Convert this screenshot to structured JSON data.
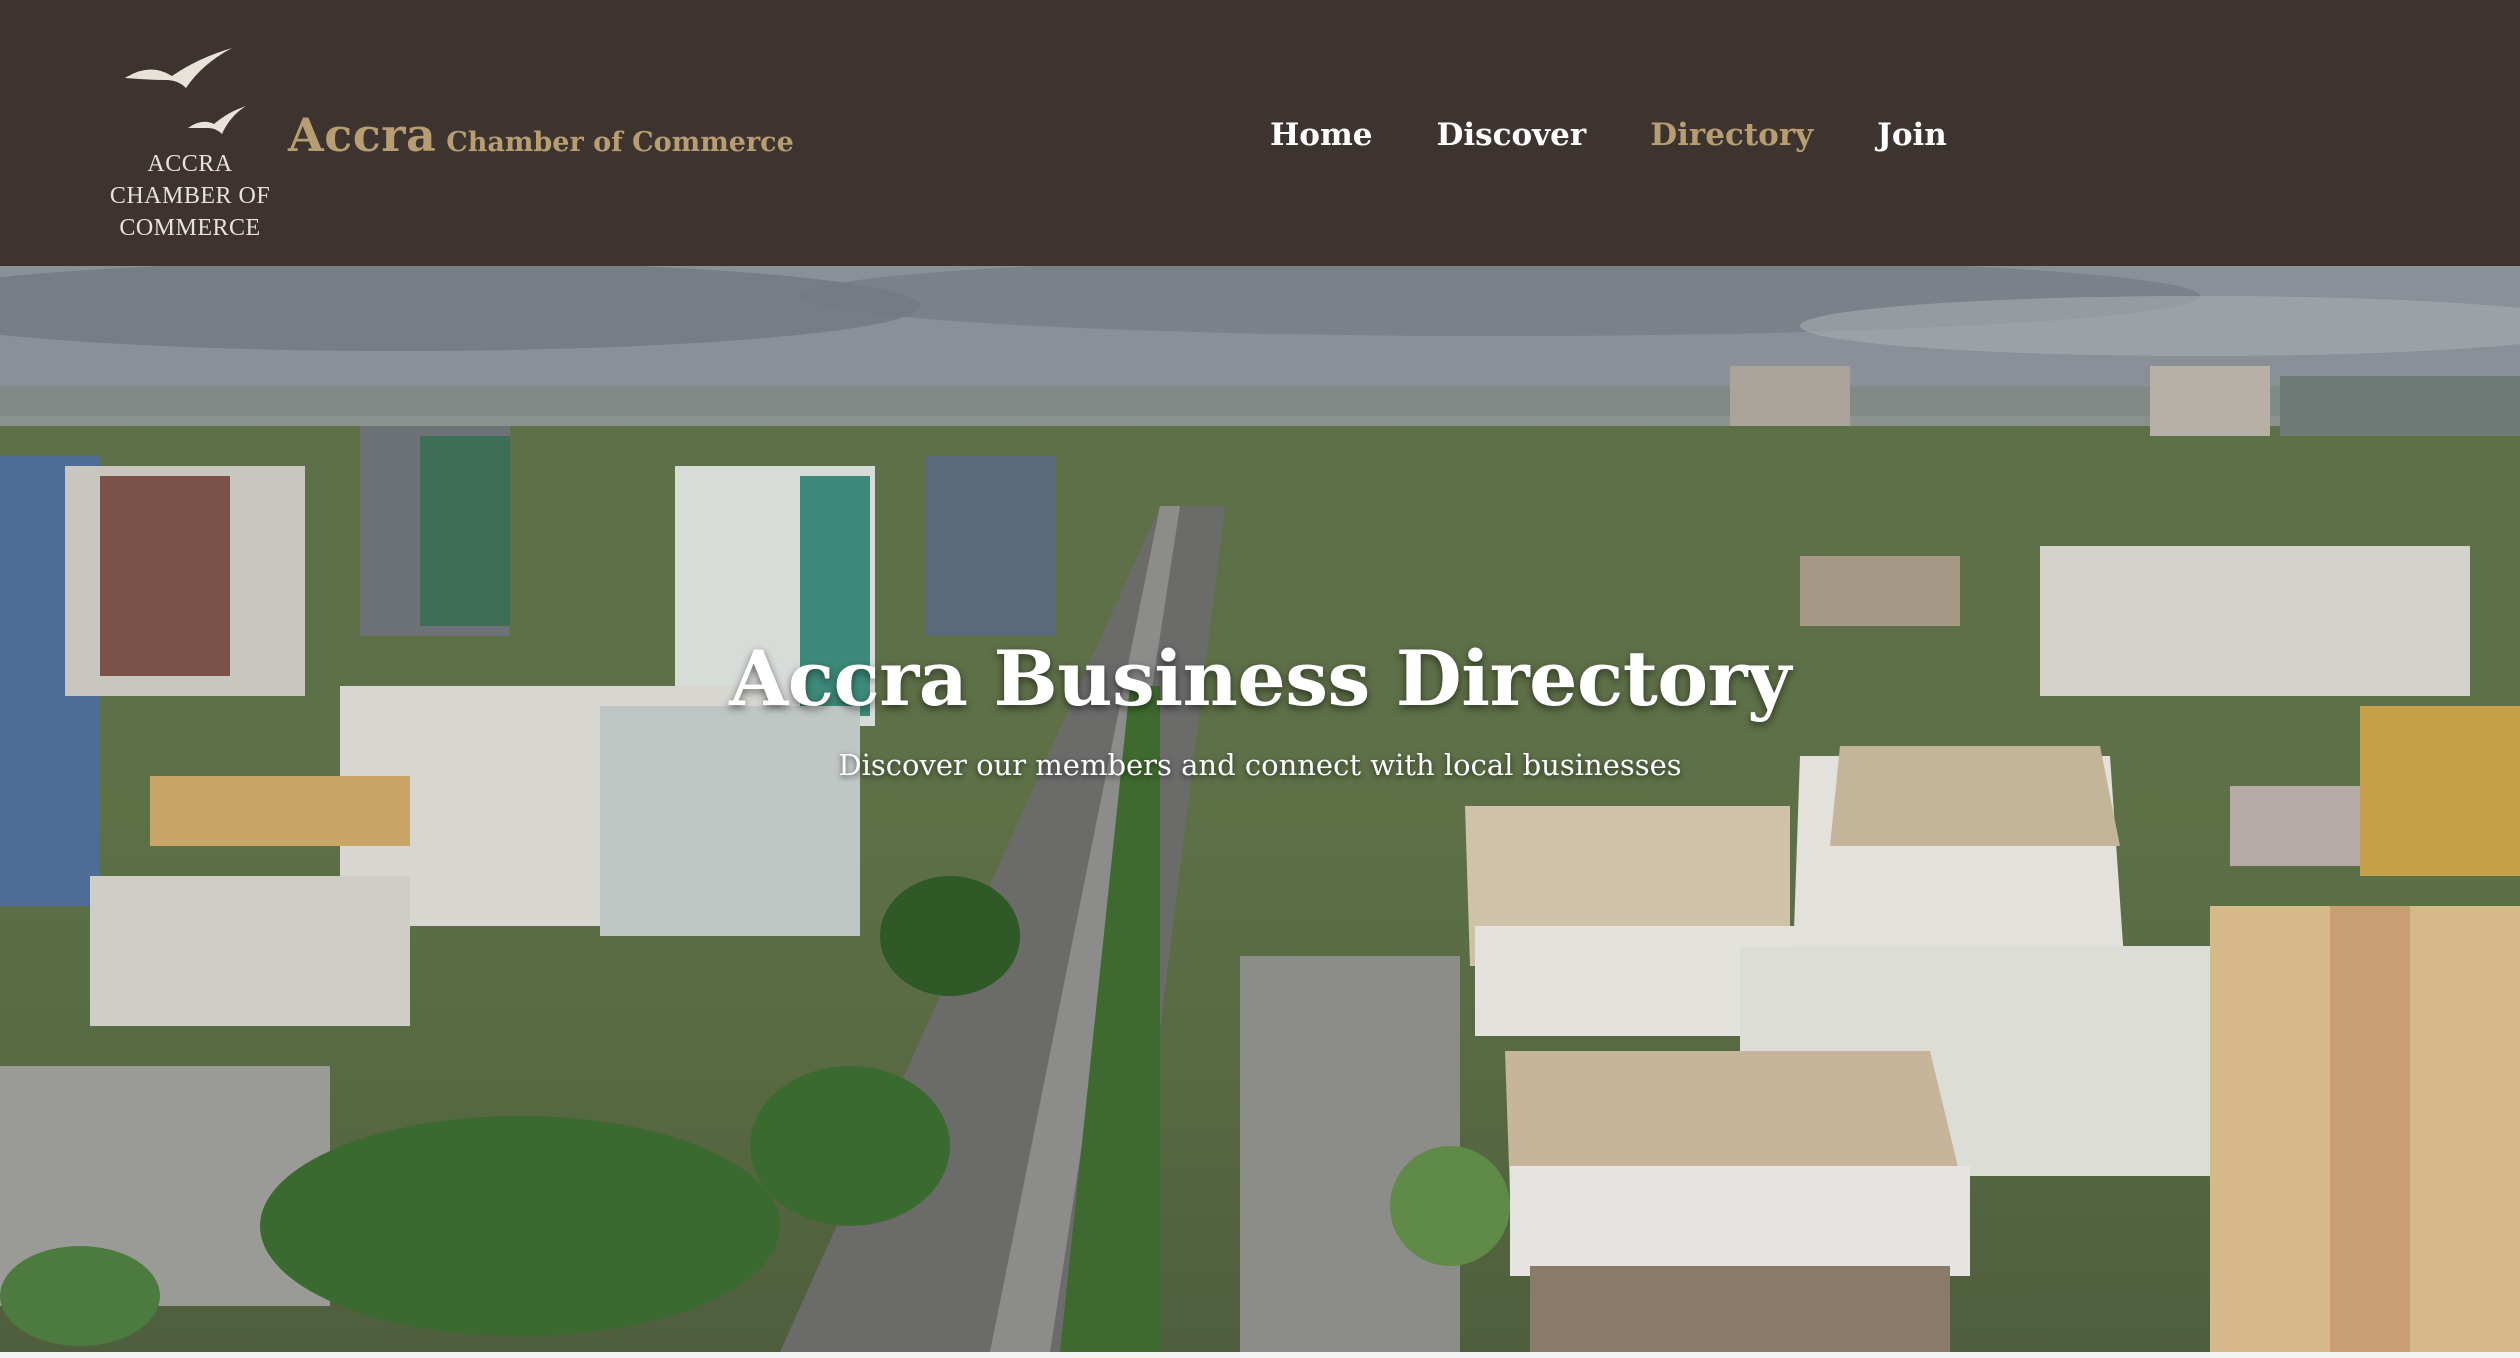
{
  "header": {
    "logo": {
      "caption": "ACCRA\nCHAMBER OF COMMERCE",
      "icon": "birds-icon"
    },
    "brand": {
      "main": "Accra",
      "sub": "Chamber of Commerce"
    },
    "nav": [
      {
        "label": "Home",
        "active": false
      },
      {
        "label": "Discover",
        "active": false
      },
      {
        "label": "Directory",
        "active": true
      },
      {
        "label": "Join",
        "active": false
      }
    ]
  },
  "hero": {
    "title": "Accra Business Directory",
    "subtitle": "Discover our members and connect with local businesses",
    "background_image": "aerial city skyline of Accra"
  },
  "colors": {
    "header_bg": "#3d342f",
    "accent_gold": "#b89d73",
    "nav_text": "#ffffff"
  }
}
